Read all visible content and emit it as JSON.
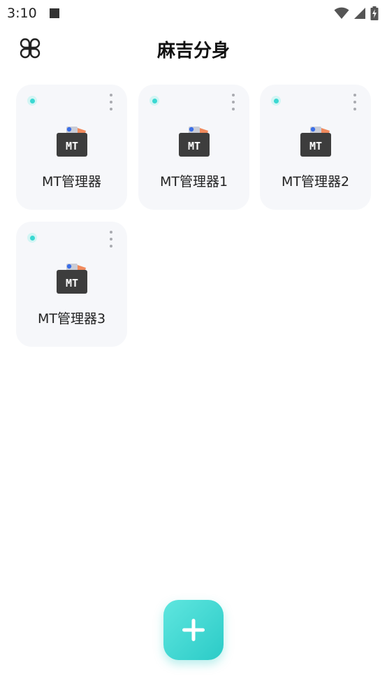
{
  "status_bar": {
    "time": "3:10",
    "icons": [
      "notification-square-icon",
      "wifi-icon",
      "cell-signal-icon",
      "battery-charging-icon"
    ]
  },
  "header": {
    "title": "麻吉分身",
    "menu_icon": "four-leaf-menu-icon"
  },
  "apps": [
    {
      "label": "MT管理器",
      "icon_text": "MT",
      "running": true
    },
    {
      "label": "MT管理器1",
      "icon_text": "MT",
      "running": true
    },
    {
      "label": "MT管理器2",
      "icon_text": "MT",
      "running": true
    },
    {
      "label": "MT管理器3",
      "icon_text": "MT",
      "running": true
    }
  ],
  "fab": {
    "icon": "plus-icon"
  },
  "colors": {
    "accent": "#3ad8d2",
    "card_bg": "#f6f7fa",
    "fab_gradient_start": "#5fe6df",
    "fab_gradient_end": "#2bcbc7"
  }
}
